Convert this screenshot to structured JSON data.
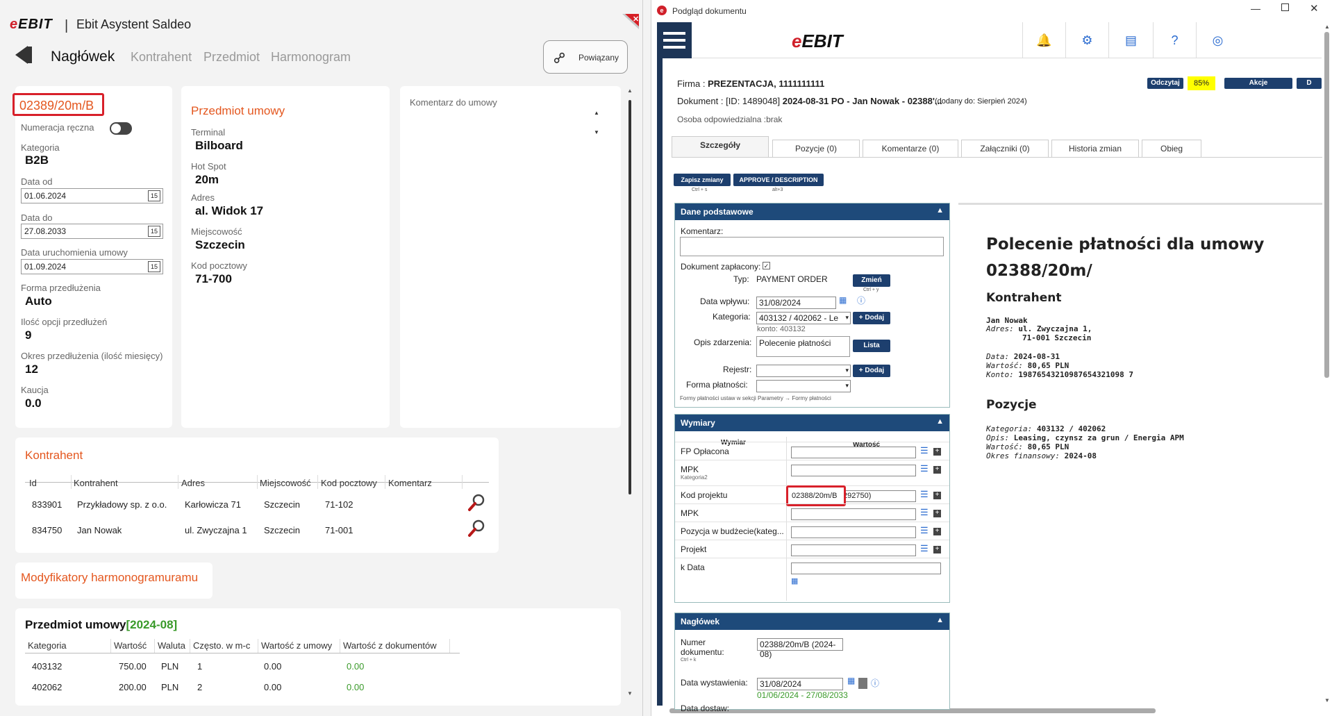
{
  "left": {
    "logo": "EBIT",
    "title": "Ebit Asystent Saldeo",
    "nav": {
      "active": "Nagłówek",
      "items": [
        "Kontrahent",
        "Przedmiot",
        "Harmonogram"
      ]
    },
    "powiazany": "Powiązany",
    "card1": {
      "contract_no": "02389/20m/B",
      "numeracja_label": "Numeracja ręczna",
      "kategoria_label": "Kategoria",
      "kategoria": "B2B",
      "data_od_label": "Data od",
      "data_od": "01.06.2024",
      "data_do_label": "Data do",
      "data_do": "27.08.2033",
      "data_uru_label": "Data uruchomienia umowy",
      "data_uru": "01.09.2024",
      "forma_label": "Forma przedłużenia",
      "forma": "Auto",
      "ilosc_label": "Ilość opcji przedłużeń",
      "ilosc": "9",
      "okres_label": "Okres przedłużenia (ilość miesięcy)",
      "okres": "12",
      "kaucja_label": "Kaucja",
      "kaucja": "0.0",
      "cal_icon": "15"
    },
    "card2": {
      "title": "Przedmiot umowy",
      "terminal_label": "Terminal",
      "terminal": "Bilboard",
      "hotspot_label": "Hot Spot",
      "hotspot": "20m",
      "adres_label": "Adres",
      "adres": "al. Widok 17",
      "miejsc_label": "Miejscowość",
      "miejsc": "Szczecin",
      "kod_label": "Kod pocztowy",
      "kod": "71-700"
    },
    "card3": {
      "comment_label": "Komentarz do umowy"
    },
    "kontrahent": {
      "title": "Kontrahent",
      "headers": [
        "Id",
        "Kontrahent",
        "Adres",
        "Miejscowość",
        "Kod pocztowy",
        "Komentarz"
      ],
      "rows": [
        [
          "833901",
          "Przykładowy sp. z o.o.",
          "Karłowicza 71",
          "Szczecin",
          "71-102",
          ""
        ],
        [
          "834750",
          "Jan Nowak",
          "ul. Zwyczajna 1",
          "Szczecin",
          "71-001",
          ""
        ]
      ]
    },
    "modyfikatory": "Modyfikatory harmonogramuramu",
    "przedmiot": {
      "title": "Przedmiot umowy",
      "period": "[2024-08]",
      "headers": [
        "Kategoria",
        "Wartość",
        "Waluta",
        "Często. w m-c",
        "Wartość z umowy",
        "Wartość z dokumentów"
      ],
      "rows": [
        [
          "403132",
          "750.00",
          "PLN",
          "1",
          "0.00",
          "0.00"
        ],
        [
          "402062",
          "200.00",
          "PLN",
          "2",
          "0.00",
          "0.00"
        ]
      ]
    }
  },
  "right": {
    "window_title": "Podgląd dokumentu",
    "logo": "EBIT",
    "firma_label": "Firma :",
    "firma": "PREZENTACJA, 1111111111",
    "dokument_label": "Dokument : [ID: 1489048]",
    "dokument": "2024-08-31 PO - Jan Nowak - 02388'...",
    "dodany": "(dodany do: Sierpień 2024)",
    "osoba": "Osoba odpowiedzialna :brak",
    "buttons": {
      "odczytaj": "Odczytaj",
      "percent": "85%",
      "akcje": "Akcje",
      "dx": "D"
    },
    "tabs": [
      "Szczegóły",
      "Pozycje (0)",
      "Komentarze (0)",
      "Załączniki (0)",
      "Historia zmian",
      "Obieg"
    ],
    "zapisz": "Zapisz zmiany",
    "zapisz_sc": "Ctrl + s",
    "approve": "APPROVE / DESCRIPTION",
    "approve_sc": "alt+3",
    "dane": {
      "title": "Dane podstawowe",
      "komentarz": "Komentarz:",
      "zaplacony": "Dokument zapłacony:",
      "typ_label": "Typ:",
      "typ": "PAYMENT ORDER",
      "zmien": "Zmień",
      "zmien_sc": "Ctrl + y",
      "data_wplywu_label": "Data wpływu:",
      "data_wplywu": "31/08/2024",
      "kategoria_label": "Kategoria:",
      "kategoria": "403132 / 402062 - Le",
      "konto": "konto: 403132",
      "dodaj": "+ Dodaj",
      "opis_label": "Opis zdarzenia:",
      "opis": "Polecenie płatności",
      "lista": "Lista",
      "rejestr_label": "Rejestr:",
      "forma_label": "Forma płatności:",
      "forma_note": "Formy płatności ustaw w sekcji Parametry → Formy płatności"
    },
    "wymiary": {
      "title": "Wymiary",
      "col1": "Wymiar",
      "col2": "Wartość",
      "rows": [
        {
          "name": "FP Opłacona",
          "sub": "",
          "value": ""
        },
        {
          "name": "MPK",
          "sub": "Kategoria2",
          "value": ""
        },
        {
          "name": "Kod projektu",
          "sub": "",
          "value": "02388/20m/B",
          "value2": "292750)"
        },
        {
          "name": "MPK",
          "sub": "",
          "value": ""
        },
        {
          "name": "Pozycja w budżecie(kateg...",
          "sub": "",
          "value": ""
        },
        {
          "name": "Projekt",
          "sub": "",
          "value": ""
        },
        {
          "name": "k Data",
          "sub": "",
          "value": ""
        }
      ]
    },
    "naglowek": {
      "title": "Nagłówek",
      "numer_label": "Numer dokumentu:",
      "numer_sc": "Ctrl + k",
      "numer": "02388/20m/B  (2024-08)",
      "data_wyst_label": "Data wystawienia:",
      "data_wyst": "31/08/2024",
      "range": "01/06/2024 - 27/08/2033",
      "data_dost_label": "Data dostaw:"
    },
    "preview": {
      "title": "Polecenie płatności dla umowy 02388/20m/",
      "kontrahent_h": "Kontrahent",
      "name": "Jan Nowak",
      "adres_label": "Adres:",
      "adres1": "ul. Zwyczajna 1,",
      "adres2": "71-001 Szczecin",
      "data_label": "Data:",
      "data": "2024-08-31",
      "wartosc_label": "Wartość:",
      "wartosc": "80,65 PLN",
      "konto_label": "Konto:",
      "konto": "19876543210987654321098 7",
      "pozycje_h": "Pozycje",
      "kat_label": "Kategoria:",
      "kat": "403132 / 402062",
      "opis_label": "Opis:",
      "opis": "Leasing, czynsz za grun / Energia APM",
      "wart_label": "Wartość:",
      "wart": "80,65 PLN",
      "okres_label": "Okres finansowy:",
      "okres": "2024-08"
    }
  }
}
